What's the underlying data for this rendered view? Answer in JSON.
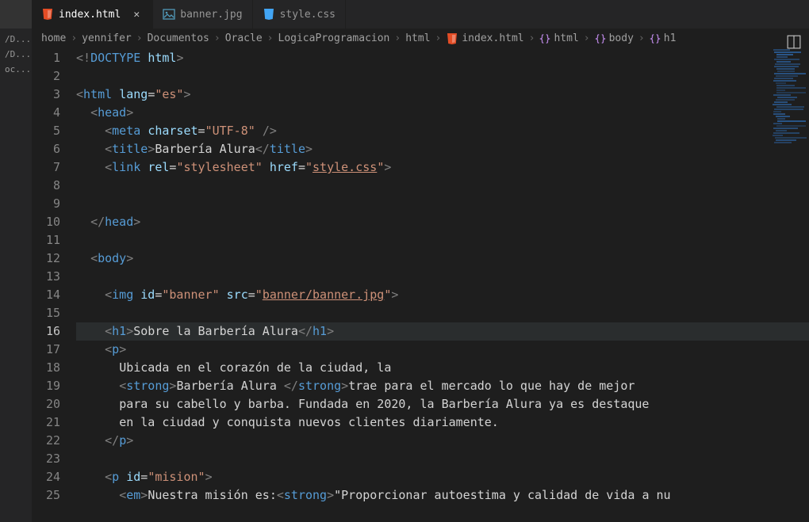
{
  "tabs": [
    {
      "label": "index.html",
      "active": true,
      "icon": "html"
    },
    {
      "label": "banner.jpg",
      "active": false,
      "icon": "image"
    },
    {
      "label": "style.css",
      "active": false,
      "icon": "css"
    }
  ],
  "sidebar_truncated": [
    "/D...",
    "/D...",
    "oc..."
  ],
  "breadcrumb": [
    {
      "label": "home"
    },
    {
      "label": "yennifer"
    },
    {
      "label": "Documentos"
    },
    {
      "label": "Oracle"
    },
    {
      "label": "LogicaProgramacion"
    },
    {
      "label": "html"
    },
    {
      "label": "index.html",
      "icon": "html"
    },
    {
      "label": "html",
      "icon": "brace"
    },
    {
      "label": "body",
      "icon": "brace"
    },
    {
      "label": "h1",
      "icon": "brace"
    }
  ],
  "current_line": 16,
  "lines": [
    {
      "n": 1,
      "tokens": [
        [
          "c-bracket",
          "<!"
        ],
        [
          "c-doctype",
          "DOCTYPE "
        ],
        [
          "c-attr",
          "html"
        ],
        [
          "c-bracket",
          ">"
        ]
      ]
    },
    {
      "n": 2,
      "tokens": []
    },
    {
      "n": 3,
      "tokens": [
        [
          "c-bracket",
          "<"
        ],
        [
          "c-tag",
          "html "
        ],
        [
          "c-attr",
          "lang"
        ],
        [
          "c-text",
          "="
        ],
        [
          "c-str",
          "\"es\""
        ],
        [
          "c-bracket",
          ">"
        ]
      ]
    },
    {
      "n": 4,
      "indent": 1,
      "tokens": [
        [
          "c-bracket",
          "<"
        ],
        [
          "c-tag",
          "head"
        ],
        [
          "c-bracket",
          ">"
        ]
      ]
    },
    {
      "n": 5,
      "indent": 2,
      "tokens": [
        [
          "c-bracket",
          "<"
        ],
        [
          "c-tag",
          "meta "
        ],
        [
          "c-attr",
          "charset"
        ],
        [
          "c-text",
          "="
        ],
        [
          "c-str",
          "\"UTF-8\""
        ],
        [
          "c-text",
          " "
        ],
        [
          "c-bracket",
          "/>"
        ]
      ]
    },
    {
      "n": 6,
      "indent": 2,
      "tokens": [
        [
          "c-bracket",
          "<"
        ],
        [
          "c-tag",
          "title"
        ],
        [
          "c-bracket",
          ">"
        ],
        [
          "c-text",
          "Barbería Alura"
        ],
        [
          "c-bracket",
          "</"
        ],
        [
          "c-tag",
          "title"
        ],
        [
          "c-bracket",
          ">"
        ]
      ]
    },
    {
      "n": 7,
      "indent": 2,
      "tokens": [
        [
          "c-bracket",
          "<"
        ],
        [
          "c-tag",
          "link "
        ],
        [
          "c-attr",
          "rel"
        ],
        [
          "c-text",
          "="
        ],
        [
          "c-str",
          "\"stylesheet\""
        ],
        [
          "c-text",
          " "
        ],
        [
          "c-attr",
          "href"
        ],
        [
          "c-text",
          "="
        ],
        [
          "c-str",
          "\""
        ],
        [
          "c-str c-link",
          "style.css"
        ],
        [
          "c-str",
          "\""
        ],
        [
          "c-bracket",
          ">"
        ]
      ]
    },
    {
      "n": 8,
      "tokens": []
    },
    {
      "n": 9,
      "tokens": []
    },
    {
      "n": 10,
      "indent": 1,
      "tokens": [
        [
          "c-bracket",
          "</"
        ],
        [
          "c-tag",
          "head"
        ],
        [
          "c-bracket",
          ">"
        ]
      ]
    },
    {
      "n": 11,
      "tokens": []
    },
    {
      "n": 12,
      "indent": 1,
      "tokens": [
        [
          "c-bracket",
          "<"
        ],
        [
          "c-tag",
          "body"
        ],
        [
          "c-bracket",
          ">"
        ]
      ]
    },
    {
      "n": 13,
      "tokens": []
    },
    {
      "n": 14,
      "indent": 2,
      "tokens": [
        [
          "c-bracket",
          "<"
        ],
        [
          "c-tag",
          "img "
        ],
        [
          "c-attr",
          "id"
        ],
        [
          "c-text",
          "="
        ],
        [
          "c-str",
          "\"banner\""
        ],
        [
          "c-text",
          " "
        ],
        [
          "c-attr",
          "src"
        ],
        [
          "c-text",
          "="
        ],
        [
          "c-str",
          "\""
        ],
        [
          "c-str c-link",
          "banner/banner.jpg"
        ],
        [
          "c-str",
          "\""
        ],
        [
          "c-bracket",
          ">"
        ]
      ]
    },
    {
      "n": 15,
      "tokens": []
    },
    {
      "n": 16,
      "indent": 2,
      "tokens": [
        [
          "c-bracket",
          "<"
        ],
        [
          "c-tag",
          "h1"
        ],
        [
          "c-bracket",
          ">"
        ],
        [
          "c-text",
          "Sobre la Barbería Alura"
        ],
        [
          "c-bracket",
          "</"
        ],
        [
          "c-tag",
          "h1"
        ],
        [
          "c-bracket",
          ">"
        ]
      ]
    },
    {
      "n": 17,
      "indent": 2,
      "tokens": [
        [
          "c-bracket",
          "<"
        ],
        [
          "c-tag",
          "p"
        ],
        [
          "c-bracket",
          ">"
        ]
      ]
    },
    {
      "n": 18,
      "indent": 3,
      "tokens": [
        [
          "c-text",
          "Ubicada en el corazón de la ciudad, la"
        ]
      ]
    },
    {
      "n": 19,
      "indent": 3,
      "tokens": [
        [
          "c-bracket",
          "<"
        ],
        [
          "c-tag",
          "strong"
        ],
        [
          "c-bracket",
          ">"
        ],
        [
          "c-text",
          "Barbería Alura "
        ],
        [
          "c-bracket",
          "</"
        ],
        [
          "c-tag",
          "strong"
        ],
        [
          "c-bracket",
          ">"
        ],
        [
          "c-text",
          "trae para el mercado lo que hay de mejor"
        ]
      ]
    },
    {
      "n": 20,
      "indent": 3,
      "tokens": [
        [
          "c-text",
          "para su cabello y barba. Fundada en 2020, la Barbería Alura ya es destaque"
        ]
      ]
    },
    {
      "n": 21,
      "indent": 3,
      "tokens": [
        [
          "c-text",
          "en la ciudad y conquista nuevos clientes diariamente."
        ]
      ]
    },
    {
      "n": 22,
      "indent": 2,
      "tokens": [
        [
          "c-bracket",
          "</"
        ],
        [
          "c-tag",
          "p"
        ],
        [
          "c-bracket",
          ">"
        ]
      ]
    },
    {
      "n": 23,
      "tokens": []
    },
    {
      "n": 24,
      "indent": 2,
      "tokens": [
        [
          "c-bracket",
          "<"
        ],
        [
          "c-tag",
          "p "
        ],
        [
          "c-attr",
          "id"
        ],
        [
          "c-text",
          "="
        ],
        [
          "c-str",
          "\"mision\""
        ],
        [
          "c-bracket",
          ">"
        ]
      ]
    },
    {
      "n": 25,
      "indent": 3,
      "tokens": [
        [
          "c-bracket",
          "<"
        ],
        [
          "c-tag",
          "em"
        ],
        [
          "c-bracket",
          ">"
        ],
        [
          "c-text",
          "Nuestra misión es:"
        ],
        [
          "c-bracket",
          "<"
        ],
        [
          "c-tag",
          "strong"
        ],
        [
          "c-bracket",
          ">"
        ],
        [
          "c-text",
          "\"Proporcionar autoestima y calidad de vida a nu"
        ]
      ]
    }
  ]
}
